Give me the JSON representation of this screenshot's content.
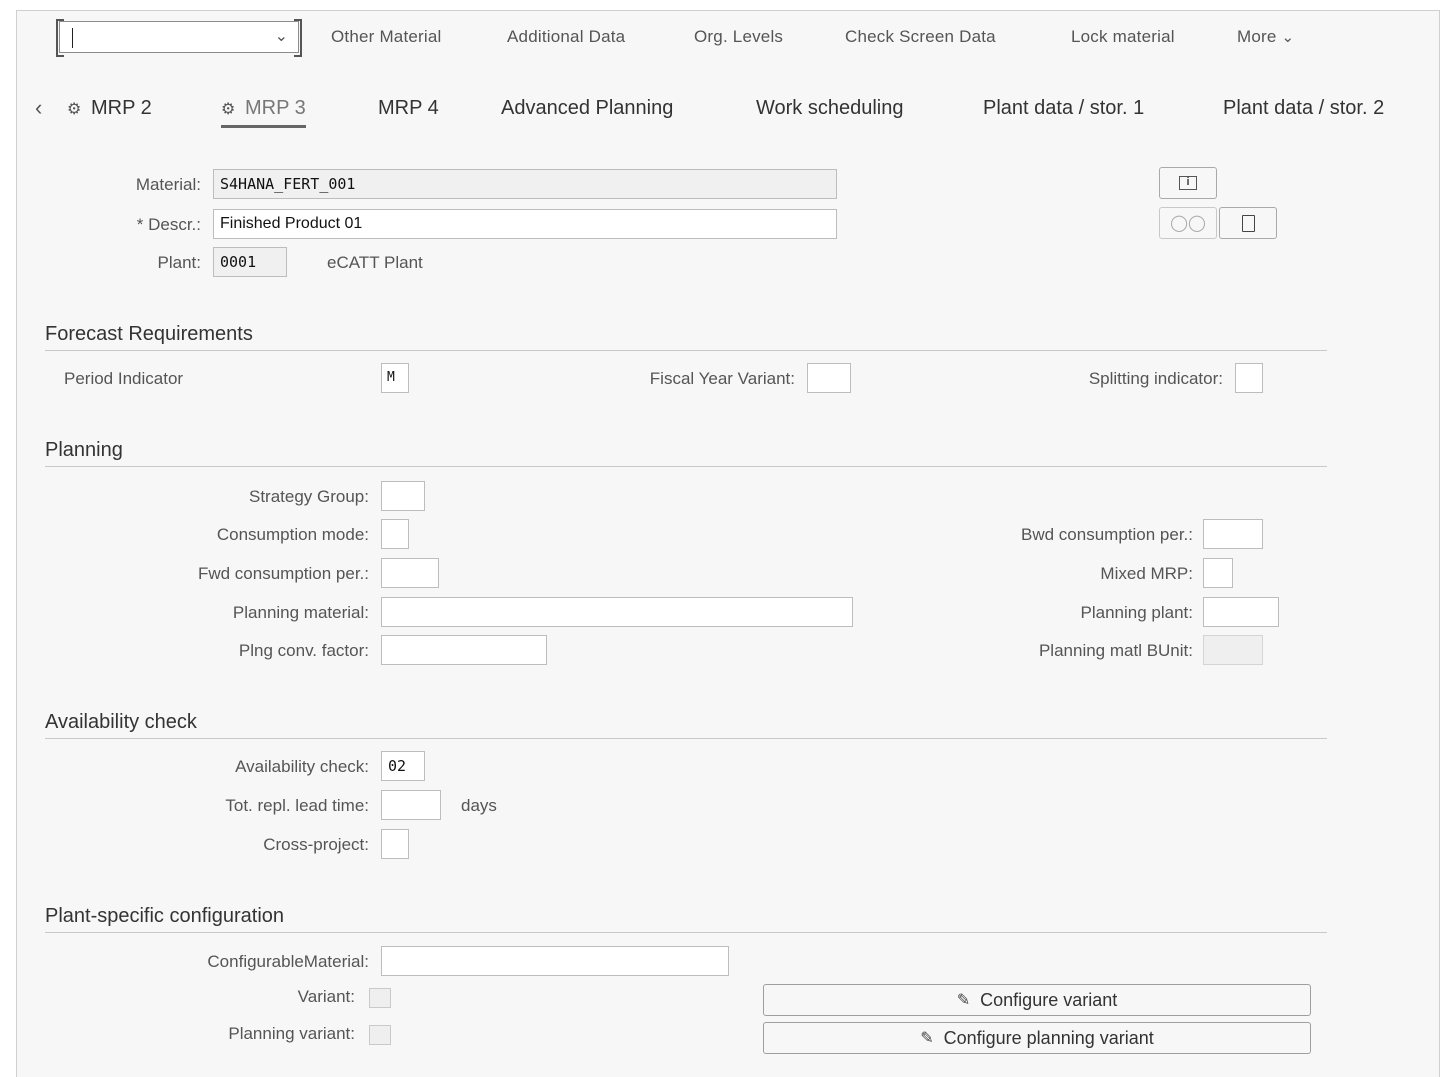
{
  "toolbar": {
    "command_value": "",
    "items": [
      "Other Material",
      "Additional Data",
      "Org. Levels",
      "Check Screen Data",
      "Lock material"
    ],
    "more_label": "More"
  },
  "tabs": [
    {
      "label": "MRP 2",
      "icon": "mrp-icon"
    },
    {
      "label": "MRP 3",
      "icon": "mrp-icon",
      "active": true
    },
    {
      "label": "MRP 4"
    },
    {
      "label": "Advanced Planning"
    },
    {
      "label": "Work scheduling"
    },
    {
      "label": "Plant data / stor. 1"
    },
    {
      "label": "Plant data / stor. 2"
    }
  ],
  "header": {
    "material_label": "Material:",
    "material_value": "S4HANA_FERT_001",
    "descr_label": "* Descr.:",
    "descr_value": "Finished Product 01",
    "plant_label": "Plant:",
    "plant_value": "0001",
    "plant_name": "eCATT Plant"
  },
  "forecast": {
    "title": "Forecast Requirements",
    "period_indicator_label": "Period Indicator",
    "period_indicator_value": "M",
    "fiscal_year_variant_label": "Fiscal Year Variant:",
    "fiscal_year_variant_value": "",
    "splitting_indicator_label": "Splitting indicator:",
    "splitting_indicator_value": ""
  },
  "planning": {
    "title": "Planning",
    "strategy_group_label": "Strategy Group:",
    "consumption_mode_label": "Consumption mode:",
    "fwd_consumption_label": "Fwd consumption per.:",
    "planning_material_label": "Planning material:",
    "plng_conv_factor_label": "Plng conv. factor:",
    "bwd_consumption_label": "Bwd consumption per.:",
    "mixed_mrp_label": "Mixed MRP:",
    "planning_plant_label": "Planning plant:",
    "planning_matl_bunit_label": "Planning matl BUnit:"
  },
  "availability": {
    "title": "Availability check",
    "availability_check_label": "Availability check:",
    "availability_check_value": "02",
    "tot_repl_lead_time_label": "Tot. repl. lead time:",
    "days_label": "days",
    "cross_project_label": "Cross-project:"
  },
  "config": {
    "title": "Plant-specific configuration",
    "configurable_material_label": "ConfigurableMaterial:",
    "variant_label": "Variant:",
    "planning_variant_label": "Planning variant:",
    "configure_variant_label": "Configure variant",
    "configure_planning_variant_label": "Configure planning variant"
  }
}
